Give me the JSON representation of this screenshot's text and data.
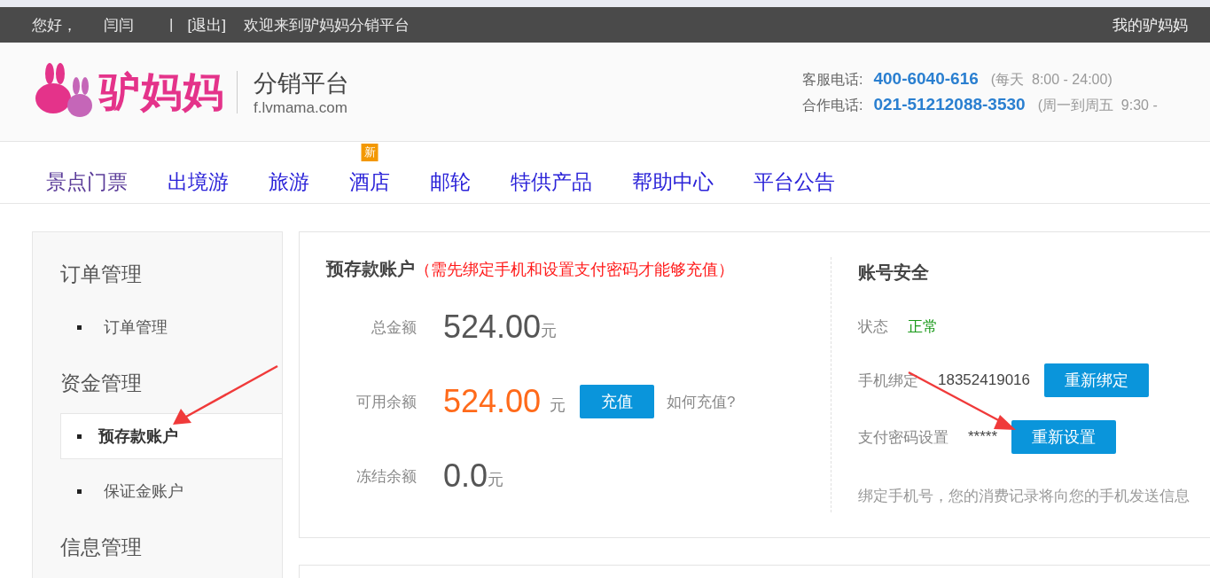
{
  "top_bar": {
    "greeting": "您好，",
    "username": "闫闫",
    "separator": "|",
    "logout": "[退出]",
    "welcome": "欢迎来到驴妈妈分销平台",
    "my_account": "我的驴妈妈"
  },
  "header": {
    "brand": "驴妈妈",
    "platform": "分销平台",
    "domain": "f.lvmama.com",
    "contacts": [
      {
        "label": "客服电话:",
        "phone": "400-6040-616",
        "hours": "(每天  8:00 - 24:00)"
      },
      {
        "label": "合作电话:",
        "phone": "021-51212088-3530",
        "hours": "(周一到周五  9:30 -"
      }
    ]
  },
  "nav": [
    {
      "label": "景点门票",
      "visited": true
    },
    {
      "label": "出境游",
      "visited": false
    },
    {
      "label": "旅游",
      "visited": false
    },
    {
      "label": "酒店",
      "visited": false,
      "badge": "新"
    },
    {
      "label": "邮轮",
      "visited": false
    },
    {
      "label": "特供产品",
      "visited": false
    },
    {
      "label": "帮助中心",
      "visited": false
    },
    {
      "label": "平台公告",
      "visited": false
    }
  ],
  "sidebar": {
    "groups": [
      {
        "title": "订单管理",
        "items": [
          {
            "label": "订单管理",
            "selected": false
          }
        ]
      },
      {
        "title": "资金管理",
        "items": [
          {
            "label": "预存款账户",
            "selected": true
          },
          {
            "label": "保证金账户",
            "selected": false
          }
        ]
      },
      {
        "title": "信息管理"
      }
    ]
  },
  "deposit": {
    "title": "预存款账户",
    "notice": "（需先绑定手机和设置支付密码才能够充值）",
    "rows": [
      {
        "kind": "plain",
        "label": "总金额",
        "amount": "524.00",
        "unit": "元"
      },
      {
        "kind": "highlight",
        "label": "可用余额",
        "amount": "524.00",
        "unit": "元",
        "button": "充值",
        "help": "如何充值?"
      },
      {
        "kind": "plain",
        "label": "冻结余额",
        "amount": "0.0",
        "unit": "元"
      }
    ]
  },
  "security": {
    "title": "账号安全",
    "status_label": "状态",
    "status": "正常",
    "rows": [
      {
        "label": "手机绑定",
        "value": "18352419016",
        "button": "重新绑定"
      },
      {
        "label": "支付密码设置",
        "value": "*****",
        "button": "重新设置"
      }
    ],
    "note": "绑定手机号，您的消费记录将向您的手机发送信息"
  }
}
